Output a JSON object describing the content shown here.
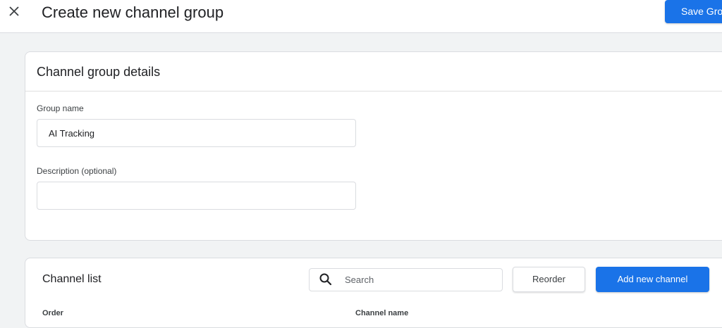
{
  "header": {
    "title": "Create new channel group",
    "save_label": "Save Gro",
    "close_icon": "close-icon",
    "accent": "#1a73e8"
  },
  "details": {
    "title": "Channel group details",
    "group_name_label": "Group name",
    "group_name_value": "AI Tracking",
    "description_label": "Description (optional)",
    "description_value": ""
  },
  "channel_list": {
    "title": "Channel list",
    "search_placeholder": "Search",
    "search_icon": "search-icon",
    "reorder_label": "Reorder",
    "add_label": "Add new channel",
    "columns": [
      "Order",
      "Channel name"
    ]
  }
}
